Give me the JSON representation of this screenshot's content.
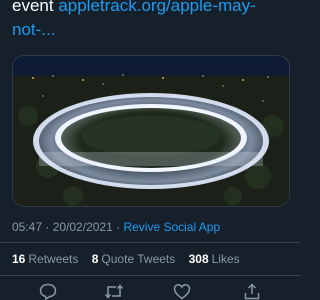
{
  "tweet": {
    "text_prefix": "event ",
    "link_line1": "appletrack.org/apple-may-",
    "link_line2": "not-..."
  },
  "media": {
    "alt_icon": "photo-of-apple-park-at-night"
  },
  "meta": {
    "time": "05:47",
    "separator1": " · ",
    "date": "20/02/2021",
    "separator2": " · ",
    "source": "Revive Social App"
  },
  "stats": {
    "retweets_count": "16",
    "retweets_label": "Retweets",
    "quote_count": "8",
    "quote_label": "Quote Tweets",
    "likes_count": "308",
    "likes_label": "Likes"
  },
  "actions": {
    "icons": [
      "reply-icon",
      "retweet-icon",
      "like-icon",
      "share-icon"
    ]
  },
  "colors": {
    "background": "#15202b",
    "link": "#1d9bf0",
    "muted": "#8899a6",
    "divider": "#38444d"
  }
}
